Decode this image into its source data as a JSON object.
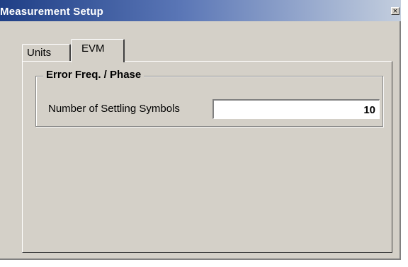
{
  "window": {
    "title": "Measurement Setup",
    "close_glyph": "×"
  },
  "tabs": [
    {
      "label": "Units",
      "selected": false
    },
    {
      "label": "EVM",
      "selected": true
    }
  ],
  "group": {
    "title": "Error Freq. / Phase",
    "fields": [
      {
        "label": "Number of Settling Symbols",
        "value": "10"
      }
    ]
  },
  "colors": {
    "title_gradient_start": "#1f3f86",
    "title_gradient_end": "#c3cede",
    "dialog_face": "#d4d0c8"
  },
  "icons": {
    "close": "close-icon"
  }
}
